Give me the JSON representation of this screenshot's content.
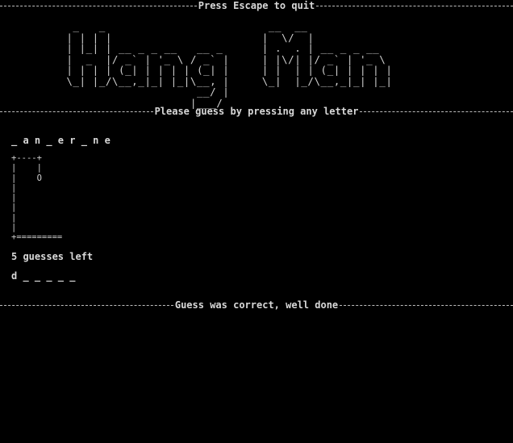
{
  "header": {
    "quit_prompt": "Press Escape to quit"
  },
  "logo": {
    "text": "HangMan",
    "ascii": [
      "     _   _                         __  __              ",
      "    | | | |                       |  \\/  |             ",
      "    | |_| | __ _ _ __   __ _      | .  . | __ _ _ __   ",
      "    |  _  |/ _` | '_ \\ / _` |     | |\\/| |/ _` | '_ \\  ",
      "    | | | | (_| | | | | (_| |     | |  | | (_| | | | | ",
      "    \\_| |_/\\__,_|_| |_|\\__, |     \\_|  |_/\\__,_|_| |_| ",
      "                        __/ |                          ",
      "                       |___/                           "
    ]
  },
  "instruction": {
    "text": "Please guess by pressing any letter"
  },
  "game": {
    "word_display": "_ a n _ e r _ n e",
    "gallows": [
      "+----+",
      "|    |",
      "|    O",
      "|",
      "|",
      "|",
      "|",
      "|",
      "+========="
    ],
    "guesses_left_text": "5 guesses left",
    "guessed_letters": "d _ _ _ _ _"
  },
  "status": {
    "message": "Guess was correct, well done"
  }
}
